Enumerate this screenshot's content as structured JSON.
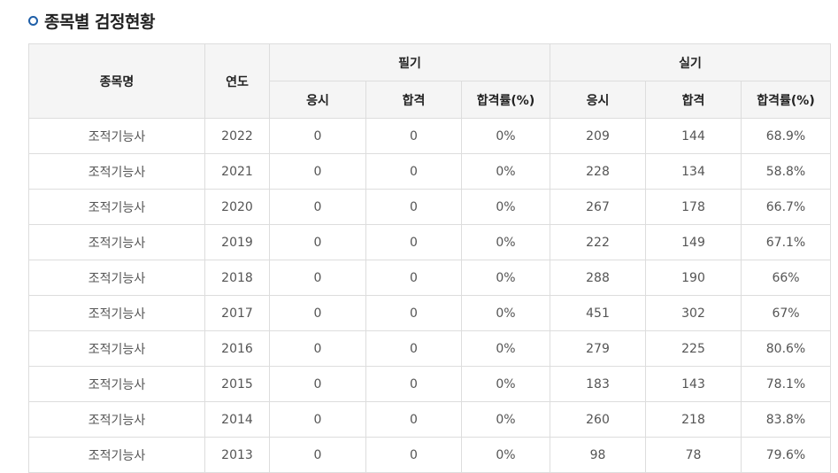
{
  "page": {
    "title": "종목별 검정현황"
  },
  "table": {
    "headers": {
      "name": "종목명",
      "year": "연도",
      "written": "필기",
      "practical": "실기",
      "applicants": "응시",
      "passed": "합격",
      "pass_rate": "합격률(%)"
    },
    "rows": [
      {
        "name": "조적기능사",
        "year": "2022",
        "w_apply": "0",
        "w_pass": "0",
        "w_rate": "0%",
        "p_apply": "209",
        "p_pass": "144",
        "p_rate": "68.9%"
      },
      {
        "name": "조적기능사",
        "year": "2021",
        "w_apply": "0",
        "w_pass": "0",
        "w_rate": "0%",
        "p_apply": "228",
        "p_pass": "134",
        "p_rate": "58.8%"
      },
      {
        "name": "조적기능사",
        "year": "2020",
        "w_apply": "0",
        "w_pass": "0",
        "w_rate": "0%",
        "p_apply": "267",
        "p_pass": "178",
        "p_rate": "66.7%"
      },
      {
        "name": "조적기능사",
        "year": "2019",
        "w_apply": "0",
        "w_pass": "0",
        "w_rate": "0%",
        "p_apply": "222",
        "p_pass": "149",
        "p_rate": "67.1%"
      },
      {
        "name": "조적기능사",
        "year": "2018",
        "w_apply": "0",
        "w_pass": "0",
        "w_rate": "0%",
        "p_apply": "288",
        "p_pass": "190",
        "p_rate": "66%"
      },
      {
        "name": "조적기능사",
        "year": "2017",
        "w_apply": "0",
        "w_pass": "0",
        "w_rate": "0%",
        "p_apply": "451",
        "p_pass": "302",
        "p_rate": "67%"
      },
      {
        "name": "조적기능사",
        "year": "2016",
        "w_apply": "0",
        "w_pass": "0",
        "w_rate": "0%",
        "p_apply": "279",
        "p_pass": "225",
        "p_rate": "80.6%"
      },
      {
        "name": "조적기능사",
        "year": "2015",
        "w_apply": "0",
        "w_pass": "0",
        "w_rate": "0%",
        "p_apply": "183",
        "p_pass": "143",
        "p_rate": "78.1%"
      },
      {
        "name": "조적기능사",
        "year": "2014",
        "w_apply": "0",
        "w_pass": "0",
        "w_rate": "0%",
        "p_apply": "260",
        "p_pass": "218",
        "p_rate": "83.8%"
      },
      {
        "name": "조적기능사",
        "year": "2013",
        "w_apply": "0",
        "w_pass": "0",
        "w_rate": "0%",
        "p_apply": "98",
        "p_pass": "78",
        "p_rate": "79.6%"
      }
    ]
  },
  "colors": {
    "bullet": "#1f5fa8",
    "header_bg": "#f5f5f5",
    "border": "#dddddd"
  }
}
